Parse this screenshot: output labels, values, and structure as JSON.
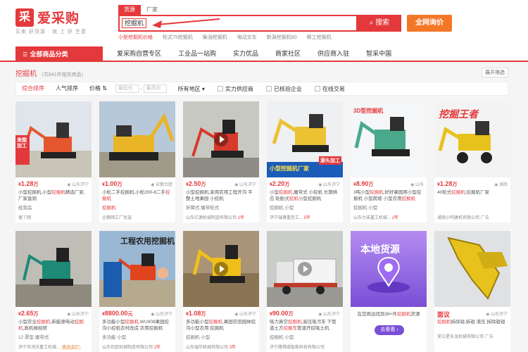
{
  "header": {
    "logo_glyph": "采",
    "brand": "爱采购",
    "slogan": "买卖 好货源 · 就 上 好 生意",
    "search_tabs": [
      "货源",
      "厂家"
    ],
    "search_value": "挖掘机",
    "search_button": "搜索",
    "inquiry_button": "全网询价",
    "hot_words": [
      "小型挖掘机价格",
      "轮式75挖掘机",
      "柴油挖掘机",
      "电动叉车",
      "新源挖掘机60",
      "柳工挖掘机"
    ]
  },
  "nav": {
    "category_label": "全部商品分类",
    "items": [
      "爱采购自营专区",
      "工业品一站购",
      "实力优品",
      "商家社区",
      "供应商入驻",
      "智采中国"
    ]
  },
  "filter": {
    "crumb_keyword": "挖掘机",
    "crumb_count": "（共841件相关商品）",
    "expand_label": "展开筛选",
    "sorts": [
      "综合排序",
      "人气排序",
      "价格"
    ],
    "price_min_placeholder": "最低价",
    "price_max_placeholder": "最高价",
    "region": "所有地区",
    "checks": [
      "实力供应商",
      "已核验企业",
      "在线交易"
    ]
  },
  "products": [
    {
      "price": "1.28",
      "unit": "万",
      "location": "山东济宁",
      "desc": [
        "小型挖掘机,小型",
        "挖掘机",
        "精选厂家,厂家直销"
      ],
      "tags": "经营品",
      "company": "搜了网",
      "extra": ""
    },
    {
      "price": "1.00",
      "unit": "万",
      "location": "安徽合肥",
      "desc": [
        "小松二手挖掘机,小松200-8二手",
        "挖掘机",
        ""
      ],
      "tags": "挖掘机",
      "company": "企鹅网工厂优选",
      "extra": ""
    },
    {
      "price": "2.50",
      "unit": "万",
      "location": "山东济宁",
      "desc": [
        "小型挖掘机,家用农用工程开沟 平整土地果园 小挖机",
        "",
        ""
      ],
      "tags": "折臂式 履带轮式",
      "company": "山东亿源机械制造有限公司",
      "extra": "1年"
    },
    {
      "price": "2.20",
      "unit": "万",
      "location": "山东济宁",
      "desc": [
        "小型",
        "挖掘机",
        ",履带式 小挖机 长期供应 轮胎式",
        "挖机",
        "小型挖掘机"
      ],
      "tags": "挖掘机 小型",
      "company": "济宁瑞锋重型工...",
      "extra": "5年"
    },
    {
      "price": "8.90",
      "unit": "万",
      "location": "山东",
      "desc": [
        "3吨小型",
        "挖掘机",
        ",好好果园用小型挖掘机 小型爬坡 小型农用",
        "挖掘机"
      ],
      "tags": "挖掘机 小型",
      "company": "山东力诺重工机械...",
      "extra": "2年"
    },
    {
      "price": "1.28",
      "unit": "万",
      "location": "湖南",
      "desc": [
        "40轮式",
        "挖掘机",
        ",挖掘机厂家",
        "",
        ""
      ],
      "tags": "",
      "company": "湖南小鸣建机有限公司",
      "extra": "广告"
    },
    {
      "price": "2.65",
      "unit": "万",
      "location": "山东济宁",
      "desc": [
        "小型农业",
        "挖掘机",
        ",新能源电动",
        "挖掘机",
        ",真机械视频"
      ],
      "tags": "12 厚型 履带式",
      "company": "济宁市鸿沃重工机械...",
      "extra": "实力工厂"
    },
    {
      "price": "8800.00",
      "unit": "元",
      "location": "山东济宁",
      "desc": [
        "多功能小型",
        "挖掘机",
        ",WU008果园挖沟小挖机农村改造 农用挖掘机",
        ""
      ],
      "tags": "多功能 小型",
      "company": "山东巨匠机械制造有限公司",
      "extra": "2年"
    },
    {
      "price": "1.08",
      "unit": "万",
      "location": "山东济宁",
      "desc": [
        "多功能小型",
        "挖掘机",
        ",果园农田园林挖沟小型农用 挖掘机",
        ""
      ],
      "tags": "挖掘机 小型",
      "company": "山东瑞华机械有限公司",
      "extra": "3年"
    },
    {
      "price": "90.00",
      "unit": "万",
      "location": "山东济宁",
      "desc": [
        "吸力真空",
        "挖掘机",
        ",高压吸污车 下管道土方",
        "挖掘车",
        "管道开挖吸土机"
      ],
      "tags": "挖掘机 小型",
      "company": "济宁路得威智能科技有限公司",
      "extra": ""
    },
    {
      "price": "",
      "unit": "",
      "location": "",
      "desc": [
        "在您周边找到38+件",
        "挖掘机",
        "货源",
        ""
      ],
      "tags": "",
      "company": "",
      "extra": ""
    },
    {
      "price": "",
      "unit": "",
      "location": "山东济宁",
      "desc": [
        "挖掘机",
        "拆除钳,拆钳 液压 拆除钳钳",
        "",
        ""
      ],
      "tags": "",
      "company": "浙江星东龙机械有限公司",
      "extra": "广告"
    }
  ],
  "overlays": {
    "card1": "来图加工",
    "card4": "小型挖掘机厂家",
    "card4b": "源头加工",
    "card5": "3D型挖掘机",
    "card6": "挖掘王者",
    "card8": "工程农用挖掘机",
    "card11_title": "本地货源",
    "card11_btn": "去看看 ›",
    "card12_top": "面议"
  }
}
